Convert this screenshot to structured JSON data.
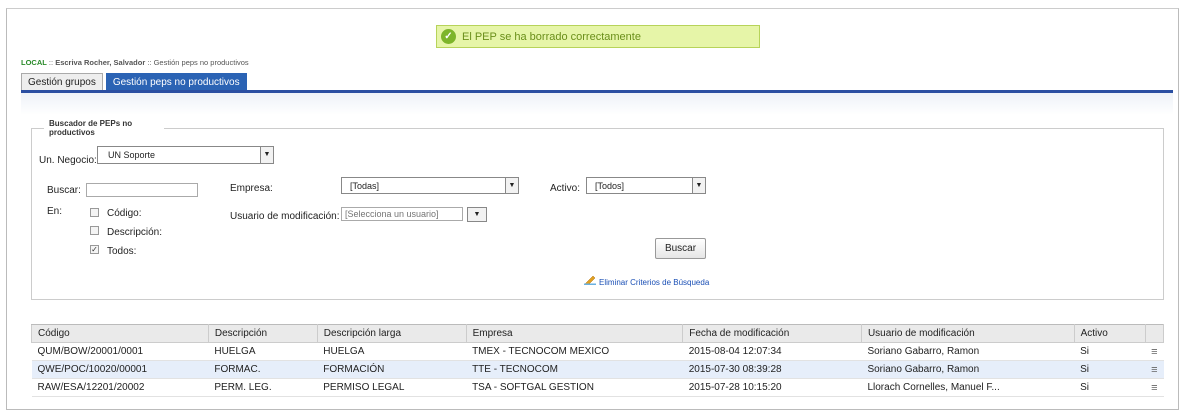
{
  "toast": {
    "message": "El PEP se ha borrado correctamente"
  },
  "breadcrumb": {
    "env": "LOCAL",
    "sep1": " :: ",
    "user": "Escriva Rocher, Salvador",
    "sep2": " :: ",
    "page": "Gestión peps no productivos"
  },
  "tabs": [
    {
      "label": "Gestión grupos"
    },
    {
      "label": "Gestión peps no productivos"
    }
  ],
  "search": {
    "legend": "Buscador de PEPs no productivos",
    "un_negocio_label": "Un. Negocio:",
    "un_negocio_value": "UN Soporte",
    "buscar_label": "Buscar:",
    "buscar_value": "",
    "en_label": "En:",
    "opt_codigo": "Código:",
    "opt_descripcion": "Descripción:",
    "opt_todos": "Todos:",
    "empresa_label": "Empresa:",
    "empresa_value": "[Todas]",
    "activo_label": "Activo:",
    "activo_value": "[Todos]",
    "usuario_label": "Usuario de modificación:",
    "usuario_placeholder": "[Selecciona un usuario]",
    "buscar_button": "Buscar",
    "clear_link": "Eliminar Criterios de Búsqueda"
  },
  "table": {
    "headers": [
      "Código",
      "Descripción",
      "Descripción larga",
      "Empresa",
      "Fecha de modificación",
      "Usuario de modificación",
      "Activo"
    ],
    "rows": [
      [
        "QUM/BOW/20001/0001",
        "HUELGA",
        "HUELGA",
        "TMEX - TECNOCOM MEXICO",
        "2015-08-04 12:07:34",
        "Soriano Gabarro, Ramon",
        "Si"
      ],
      [
        "QWE/POC/10020/00001",
        "FORMAC.",
        "FORMACIÓN",
        "TTE - TECNOCOM",
        "2015-07-30 08:39:28",
        "Soriano Gabarro, Ramon",
        "Si"
      ],
      [
        "RAW/ESA/12201/20002",
        "PERM. LEG.",
        "PERMISO LEGAL",
        "TSA - SOFTGAL GESTION",
        "2015-07-28 10:15:20",
        "Llorach Cornelles, Manuel F...",
        "Si"
      ]
    ]
  },
  "colors": {
    "tab_active": "#2b63b4",
    "toast_bg": "#e6f5a8",
    "row_alt": "#e6eefa"
  },
  "icons": {
    "toast": "check-circle-icon",
    "clear": "pencil-eraser-icon",
    "row_menu": "hamburger-menu-icon"
  }
}
